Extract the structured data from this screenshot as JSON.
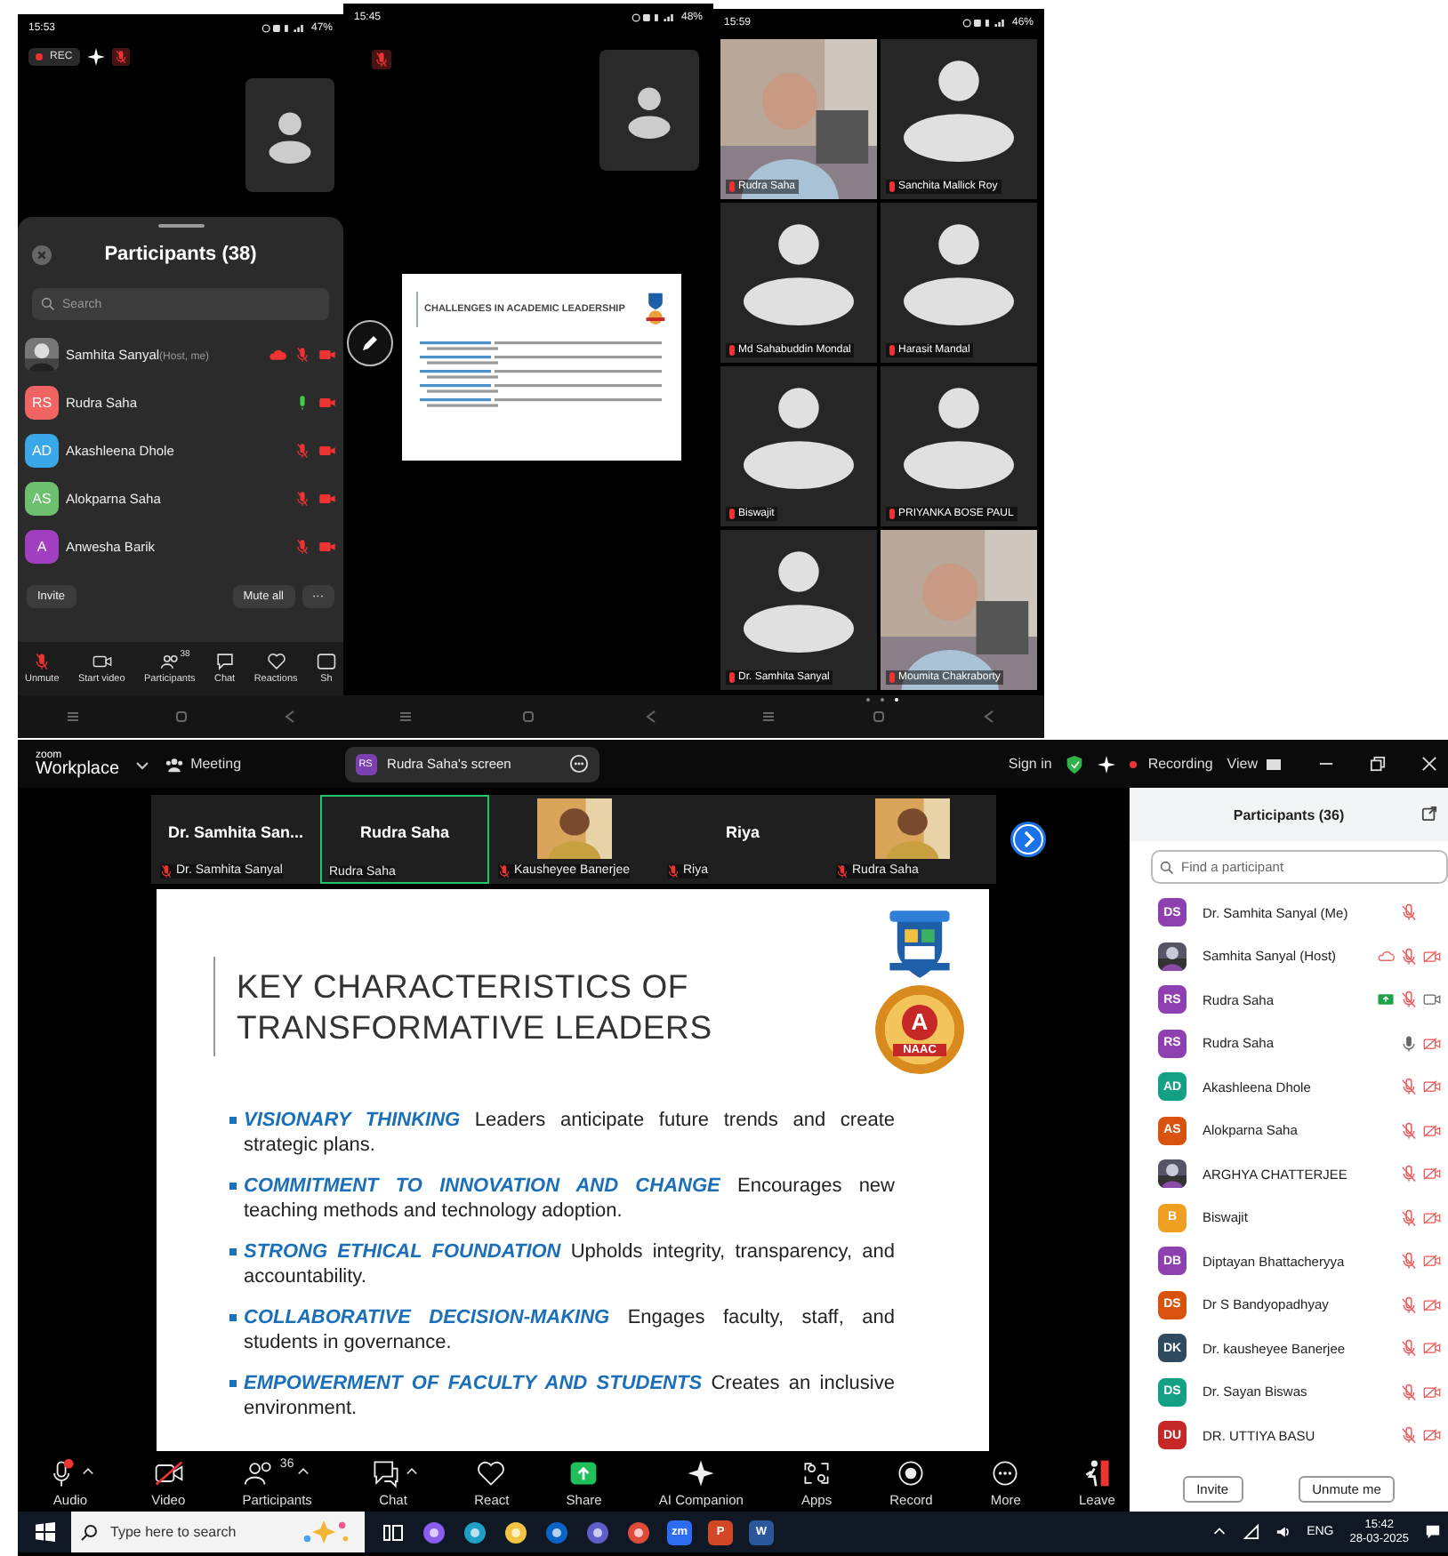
{
  "phone_participants": {
    "time": "15:53",
    "battery": "47%",
    "rec": "REC",
    "title": "Participants (38)",
    "search_placeholder": "Search",
    "participants": [
      {
        "name": "Samhita Sanyal",
        "role": "(Host, me)",
        "cloud": true,
        "mic_on": false
      },
      {
        "kind": "initials",
        "name": "Rudra Saha",
        "initials": "RS",
        "color": "#f06464",
        "cloud": false,
        "mic_on": true
      },
      {
        "kind": "initials",
        "name": "Akashleena Dhole",
        "initials": "AD",
        "color": "#3aa8e8",
        "cloud": false,
        "mic_on": false
      },
      {
        "kind": "initials",
        "name": "Alokparna Saha",
        "initials": "AS",
        "color": "#6cc070",
        "cloud": false,
        "mic_on": false
      },
      {
        "kind": "initials",
        "name": "Anwesha Barik",
        "initials": "A",
        "color": "#a040c0",
        "cloud": false,
        "mic_on": false
      }
    ],
    "invite": "Invite",
    "mute_all": "Mute all",
    "more": "···",
    "toolbar": [
      {
        "kind": "mic-muted",
        "label": "Unmute"
      },
      {
        "kind": "video",
        "label": "Start video"
      },
      {
        "kind": "people",
        "label": "Participants",
        "count": "38"
      },
      {
        "kind": "chat",
        "label": "Chat"
      },
      {
        "kind": "heart",
        "label": "Reactions"
      },
      {
        "kind": "share",
        "label": "Sh"
      }
    ]
  },
  "phone_share": {
    "time": "15:45",
    "battery": "48%",
    "slide_title": "CHALLENGES IN ACADEMIC LEADERSHIP"
  },
  "phone_gallery": {
    "time": "15:59",
    "battery": "46%",
    "tiles": [
      {
        "name": "Rudra Saha",
        "kind": "video"
      },
      {
        "name": "Sanchita Mallick Roy",
        "kind": "avatar"
      },
      {
        "name": "Md Sahabuddin Mondal",
        "kind": "avatar"
      },
      {
        "name": "Harasit Mandal",
        "kind": "avatar"
      },
      {
        "name": "Biswajit",
        "kind": "avatar"
      },
      {
        "name": "PRIYANKA BOSE PAUL",
        "kind": "avatar"
      },
      {
        "name": "Dr. Samhita Sanyal",
        "kind": "avatar"
      },
      {
        "name": "Moumita Chakraborty",
        "kind": "video"
      }
    ]
  },
  "desktop": {
    "logo_top": "zoom",
    "logo_bottom": "Workplace",
    "meeting": "Meeting",
    "share_initials": "RS",
    "share_label": "Rudra Saha's screen",
    "sign_in": "Sign in",
    "recording": "Recording",
    "view": "View",
    "thumbnails": [
      {
        "kind": "name",
        "title": "Dr. Samhita San...",
        "label": "Dr. Samhita Sanyal",
        "muted": true,
        "speaking": false
      },
      {
        "kind": "name",
        "title": "Rudra Saha",
        "label": "Rudra Saha",
        "muted": false,
        "speaking": true
      },
      {
        "kind": "video",
        "label": "Kausheyee Banerjee",
        "muted": true,
        "speaking": false
      },
      {
        "kind": "name",
        "title": "Riya",
        "label": "Riya",
        "muted": true,
        "speaking": false
      },
      {
        "kind": "video",
        "label": "Rudra Saha",
        "muted": true,
        "speaking": false
      }
    ],
    "slide": {
      "title": "KEY CHARACTERISTICS OF TRANSFORMATIVE LEADERS",
      "naac_grade": "A",
      "naac_label": "NAAC",
      "bullets": [
        {
          "lead": "VISIONARY THINKING",
          "text": "Leaders anticipate future trends and create strategic plans."
        },
        {
          "lead": "COMMITMENT TO INNOVATION AND CHANGE",
          "text": "Encourages new teaching methods and technology adoption."
        },
        {
          "lead": "STRONG ETHICAL FOUNDATION",
          "text": "Upholds integrity, transparency, and accountability."
        },
        {
          "lead": "COLLABORATIVE DECISION-MAKING",
          "text": "Engages faculty, staff, and students in governance."
        },
        {
          "lead": "EMPOWERMENT OF FACULTY AND STUDENTS",
          "text": "Creates an inclusive environment."
        }
      ]
    },
    "toolbar": [
      {
        "kind": "audio",
        "label": "Audio",
        "caret": true
      },
      {
        "kind": "video",
        "label": "Video",
        "caret": false
      },
      {
        "kind": "participants",
        "label": "Participants",
        "count": "36",
        "caret": true
      },
      {
        "kind": "chat",
        "label": "Chat",
        "caret": true
      },
      {
        "kind": "react",
        "label": "React",
        "caret": false
      },
      {
        "kind": "share",
        "label": "Share",
        "caret": false
      },
      {
        "kind": "ai",
        "label": "AI Companion",
        "caret": false
      },
      {
        "kind": "apps",
        "label": "Apps",
        "caret": false
      },
      {
        "kind": "record",
        "label": "Record",
        "caret": false
      },
      {
        "kind": "more",
        "label": "More",
        "caret": false
      },
      {
        "kind": "leave",
        "label": "Leave",
        "caret": false
      }
    ],
    "panel": {
      "title": "Participants (36)",
      "search_placeholder": "Find a participant",
      "invite": "Invite",
      "unmute": "Unmute me",
      "participants": [
        {
          "kind": "initials",
          "name": "Dr. Samhita Sanyal (Me)",
          "initials": "DS",
          "color": "#8e3fb0",
          "cloud": false,
          "sharing": false,
          "muted": true
        },
        {
          "name": "Samhita Sanyal (Host)",
          "cloud": true,
          "sharing": false,
          "muted": true,
          "video": false
        },
        {
          "kind": "initials",
          "name": "Rudra Saha",
          "initials": "RS",
          "color": "#8e3fb0",
          "cloud": false,
          "sharing": true,
          "muted": true,
          "video": true
        },
        {
          "kind": "initials",
          "name": "Rudra Saha",
          "initials": "RS",
          "color": "#8e3fb0",
          "cloud": false,
          "sharing": false,
          "muted": false,
          "video": false
        },
        {
          "kind": "initials",
          "name": "Akashleena Dhole",
          "initials": "AD",
          "color": "#13a085",
          "cloud": false,
          "sharing": false,
          "muted": true,
          "video": false
        },
        {
          "kind": "initials",
          "name": "Alokparna Saha",
          "initials": "AS",
          "color": "#d9530f",
          "cloud": false,
          "sharing": false,
          "muted": true,
          "video": false
        },
        {
          "name": "ARGHYA CHATTERJEE",
          "cloud": false,
          "sharing": false,
          "muted": true,
          "video": false
        },
        {
          "kind": "initials",
          "name": "Biswajit",
          "initials": "B",
          "color": "#f0a020",
          "cloud": false,
          "sharing": false,
          "muted": true,
          "video": false
        },
        {
          "kind": "initials",
          "name": "Diptayan Bhattacheryya",
          "initials": "DB",
          "color": "#8e3fb0",
          "cloud": false,
          "sharing": false,
          "muted": true,
          "video": false
        },
        {
          "kind": "initials",
          "name": "Dr S Bandyopadhyay",
          "initials": "DS",
          "color": "#d9530f",
          "cloud": false,
          "sharing": false,
          "muted": true,
          "video": false
        },
        {
          "kind": "initials",
          "name": "Dr. kausheyee Banerjee",
          "initials": "DK",
          "color": "#2e4a5e",
          "cloud": false,
          "sharing": false,
          "muted": true,
          "video": false
        },
        {
          "kind": "initials",
          "name": "Dr. Sayan Biswas",
          "initials": "DS",
          "color": "#13a085",
          "cloud": false,
          "sharing": false,
          "muted": true,
          "video": false
        },
        {
          "kind": "initials",
          "name": "DR. UTTIYA BASU",
          "initials": "DU",
          "color": "#c62828",
          "cloud": false,
          "sharing": false,
          "muted": true,
          "video": false
        }
      ]
    }
  },
  "taskbar": {
    "search_placeholder": "Type here to search",
    "apps": [
      {
        "kind": "taskview",
        "color": "#ffffff"
      },
      {
        "kind": "glyph",
        "color": "#8a5cf0"
      },
      {
        "kind": "glyph",
        "color": "#1fa0c8"
      },
      {
        "kind": "glyph",
        "color": "#f4c542"
      },
      {
        "kind": "glyph",
        "color": "#0a64c8"
      },
      {
        "kind": "glyph",
        "color": "#5b5fc7"
      },
      {
        "kind": "glyph",
        "color": "#e04a3a"
      },
      {
        "kind": "tile",
        "color": "#2d6cf0",
        "label": "zm"
      },
      {
        "kind": "tile",
        "color": "#d24726",
        "label": "P"
      },
      {
        "kind": "tile",
        "color": "#2b579a",
        "label": "W"
      }
    ],
    "language": "ENG",
    "time": "15:42",
    "date": "28-03-2025"
  }
}
